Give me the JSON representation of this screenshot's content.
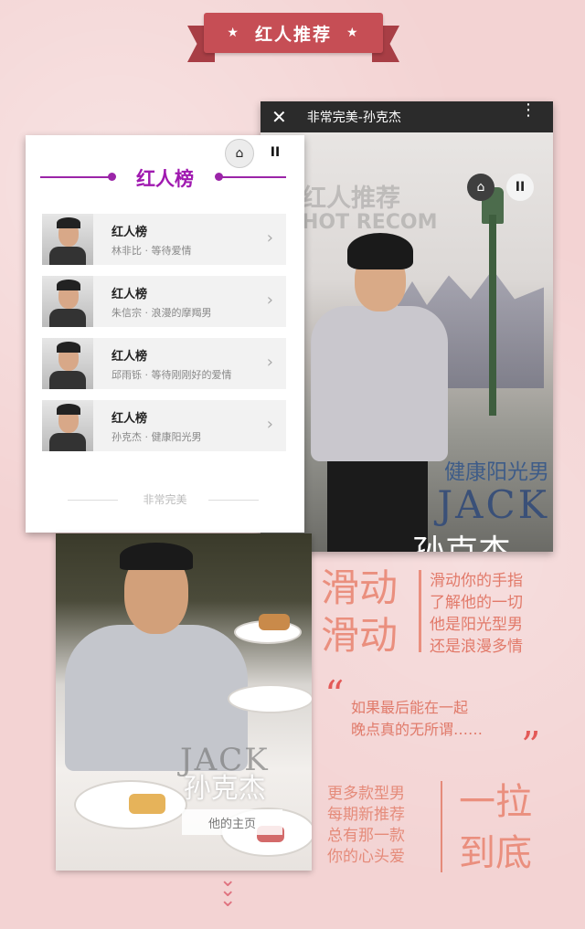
{
  "ribbon": {
    "title": "红人推荐",
    "star": "★"
  },
  "right_phone": {
    "window_title": "非常完美-孙克杰",
    "close_icon": "✕",
    "more_icon": "⋮",
    "home_icon": "⌂",
    "pause_icon": "II",
    "watermark_cn": "红人推荐",
    "watermark_en": "HOT RECOM",
    "tag_cn": "健康阳光男",
    "tag_en": "JACK",
    "tag_name": "孙克杰",
    "chevron": "︿"
  },
  "left_phone": {
    "home_icon": "⌂",
    "pause_icon": "II",
    "title": "红人榜",
    "items": [
      {
        "title": "红人榜",
        "subtitle": "林非比 · 等待爱情"
      },
      {
        "title": "红人榜",
        "subtitle": "朱信宗 · 浪漫的摩羯男"
      },
      {
        "title": "红人榜",
        "subtitle": "邱雨铄 · 等待刚刚好的爱情"
      },
      {
        "title": "红人榜",
        "subtitle": "孙克杰 · 健康阳光男"
      }
    ],
    "item_chevron": "›",
    "footer": "非常完美"
  },
  "tea_photo": {
    "watermark_en": "JACK",
    "watermark_cn": "孙克杰",
    "button": "他的主页"
  },
  "copy": {
    "slide_big_1": "滑动",
    "slide_big_2": "滑动",
    "slide_lines": [
      "滑动你的手指",
      "了解他的一切",
      "他是阳光型男",
      "还是浪漫多情"
    ],
    "quote_open": "“",
    "quote_close": "”",
    "quote_lines": [
      "如果最后能在一起",
      "晚点真的无所谓……"
    ],
    "more_lines": [
      "更多款型男",
      "每期新推荐",
      "总有那一款",
      "你的心头爱"
    ],
    "pull_1": "一拉",
    "pull_2": "到底",
    "down_arrow": "⌄"
  },
  "colors": {
    "ribbon": "#c64e55",
    "accent_purple": "#a01ab0",
    "copy_pink": "#ea8f7e",
    "quote_red": "#e35a58"
  }
}
